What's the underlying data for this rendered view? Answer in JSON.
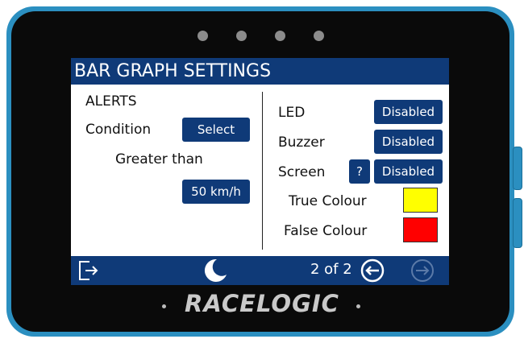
{
  "screen": {
    "title": "BAR GRAPH SETTINGS",
    "left": {
      "alerts_label": "ALERTS",
      "condition_label": "Condition",
      "condition_button": "Select",
      "condition_value": "Greater than",
      "threshold_button": "50 km/h"
    },
    "right": {
      "led_label": "LED",
      "led_button": "Disabled",
      "buzzer_label": "Buzzer",
      "buzzer_button": "Disabled",
      "screen_label": "Screen",
      "help_button": "?",
      "screen_button": "Disabled",
      "true_colour_label": "True Colour",
      "true_colour": "#ffff00",
      "false_colour_label": "False Colour",
      "false_colour": "#ff0000"
    },
    "bottom": {
      "page_indicator": "2 of 2",
      "icons": [
        "exit-icon",
        "moon-icon",
        "arrow-left-icon",
        "arrow-right-icon"
      ]
    }
  },
  "device": {
    "brand": "RACELOGIC"
  },
  "colors": {
    "accent_blue": "#0f3a78",
    "device_blue": "#2b8fc0"
  }
}
